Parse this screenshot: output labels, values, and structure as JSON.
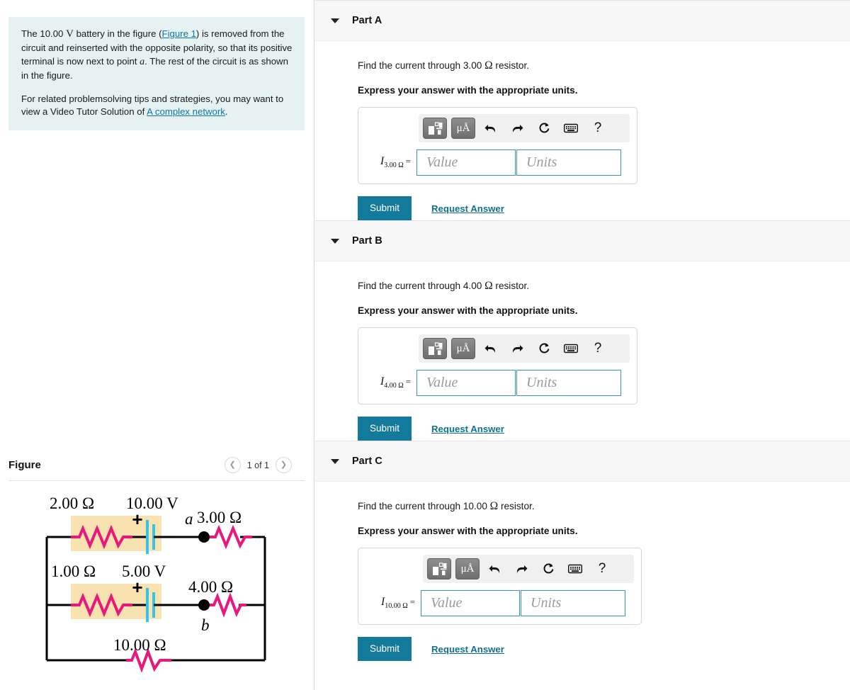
{
  "problem": {
    "paragraph1_pre": "The 10.00 ",
    "paragraph1_unit": "V",
    "paragraph1_mid": " battery in the figure (",
    "figure_link": "Figure 1",
    "paragraph1_mid2": ") is removed from the circuit and reinserted with the opposite polarity, so that its positive terminal is now next to point ",
    "point_label": "a",
    "paragraph1_end": ". The rest of the circuit is as shown in the figure.",
    "paragraph2_pre": "For related problemsolving tips and strategies, you may want to view a Video Tutor Solution of ",
    "video_link": "A complex network",
    "paragraph2_end": "."
  },
  "figure_panel": {
    "title": "Figure",
    "prev_icon": "chevron-left-icon",
    "next_icon": "chevron-right-icon",
    "counter": "1 of 1"
  },
  "circuit": {
    "labels": {
      "r_2ohm": "2.00 Ω",
      "v_10volt": "10.00 V",
      "node_a": "a",
      "r_3ohm": "3.00 Ω",
      "r_1ohm": "1.00 Ω",
      "v_5volt": "5.00 V",
      "r_4ohm": "4.00 Ω",
      "node_b": "b",
      "r_10ohm": "10.00 Ω",
      "plus_top": "+",
      "plus_mid": "+"
    },
    "colors": {
      "resistor": "#e8197d",
      "wire": "#000000",
      "highlight": "#f8e3b0",
      "battery_plate": "#36c3e8"
    }
  },
  "toolbar": {
    "template_icon": "math-template-icon",
    "units_icon": "micro-angstrom-units-icon",
    "units_label": "μÅ",
    "undo_icon": "undo-arrow-icon",
    "redo_icon": "redo-arrow-icon",
    "reset_icon": "reset-circular-arrow-icon",
    "keyboard_icon": "keyboard-icon",
    "help_icon": "help-question-icon",
    "help_label": "?"
  },
  "common": {
    "instruction": "Express your answer with the appropriate units.",
    "value_placeholder": "Value",
    "units_placeholder": "Units",
    "submit_label": "Submit",
    "request_answer_label": "Request Answer",
    "equals": "=",
    "current_symbol": "I",
    "caret_icon": "caret-down-icon"
  },
  "parts": [
    {
      "label": "Part A",
      "prompt_pre": "Find the current through 3.00 ",
      "prompt_ohm": "Ω",
      "prompt_post": " resistor.",
      "subscript": "3.00 Ω"
    },
    {
      "label": "Part B",
      "prompt_pre": "Find the current through 4.00 ",
      "prompt_ohm": "Ω",
      "prompt_post": " resistor.",
      "subscript": "4.00 Ω"
    },
    {
      "label": "Part C",
      "prompt_pre": "Find the current through 10.00 ",
      "prompt_ohm": "Ω",
      "prompt_post": " resistor.",
      "subscript": "10.00 Ω"
    }
  ],
  "colors": {
    "accent_teal": "#147a9b",
    "link_teal": "#1074a6",
    "statement_bg": "#e6f2f2",
    "header_bg": "#f7f7f7"
  }
}
